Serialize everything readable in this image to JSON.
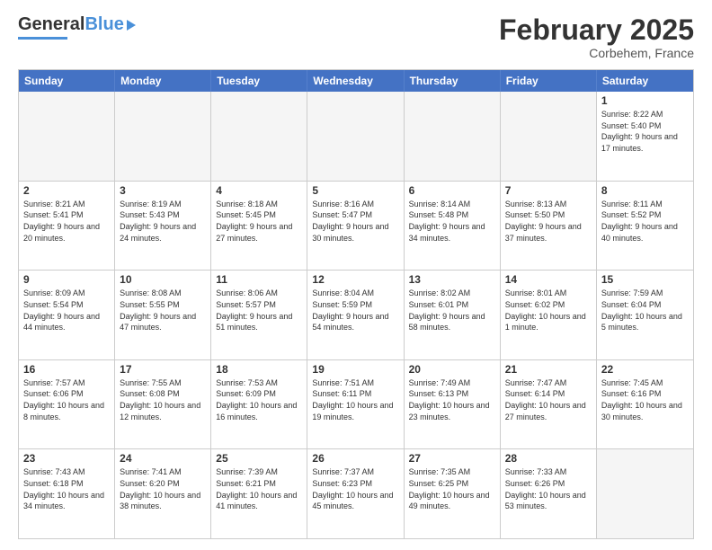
{
  "header": {
    "logo_general": "General",
    "logo_blue": "Blue",
    "month_title": "February 2025",
    "location": "Corbehem, France"
  },
  "weekdays": [
    "Sunday",
    "Monday",
    "Tuesday",
    "Wednesday",
    "Thursday",
    "Friday",
    "Saturday"
  ],
  "weeks": [
    [
      {
        "day": "",
        "info": ""
      },
      {
        "day": "",
        "info": ""
      },
      {
        "day": "",
        "info": ""
      },
      {
        "day": "",
        "info": ""
      },
      {
        "day": "",
        "info": ""
      },
      {
        "day": "",
        "info": ""
      },
      {
        "day": "1",
        "info": "Sunrise: 8:22 AM\nSunset: 5:40 PM\nDaylight: 9 hours and 17 minutes."
      }
    ],
    [
      {
        "day": "2",
        "info": "Sunrise: 8:21 AM\nSunset: 5:41 PM\nDaylight: 9 hours and 20 minutes."
      },
      {
        "day": "3",
        "info": "Sunrise: 8:19 AM\nSunset: 5:43 PM\nDaylight: 9 hours and 24 minutes."
      },
      {
        "day": "4",
        "info": "Sunrise: 8:18 AM\nSunset: 5:45 PM\nDaylight: 9 hours and 27 minutes."
      },
      {
        "day": "5",
        "info": "Sunrise: 8:16 AM\nSunset: 5:47 PM\nDaylight: 9 hours and 30 minutes."
      },
      {
        "day": "6",
        "info": "Sunrise: 8:14 AM\nSunset: 5:48 PM\nDaylight: 9 hours and 34 minutes."
      },
      {
        "day": "7",
        "info": "Sunrise: 8:13 AM\nSunset: 5:50 PM\nDaylight: 9 hours and 37 minutes."
      },
      {
        "day": "8",
        "info": "Sunrise: 8:11 AM\nSunset: 5:52 PM\nDaylight: 9 hours and 40 minutes."
      }
    ],
    [
      {
        "day": "9",
        "info": "Sunrise: 8:09 AM\nSunset: 5:54 PM\nDaylight: 9 hours and 44 minutes."
      },
      {
        "day": "10",
        "info": "Sunrise: 8:08 AM\nSunset: 5:55 PM\nDaylight: 9 hours and 47 minutes."
      },
      {
        "day": "11",
        "info": "Sunrise: 8:06 AM\nSunset: 5:57 PM\nDaylight: 9 hours and 51 minutes."
      },
      {
        "day": "12",
        "info": "Sunrise: 8:04 AM\nSunset: 5:59 PM\nDaylight: 9 hours and 54 minutes."
      },
      {
        "day": "13",
        "info": "Sunrise: 8:02 AM\nSunset: 6:01 PM\nDaylight: 9 hours and 58 minutes."
      },
      {
        "day": "14",
        "info": "Sunrise: 8:01 AM\nSunset: 6:02 PM\nDaylight: 10 hours and 1 minute."
      },
      {
        "day": "15",
        "info": "Sunrise: 7:59 AM\nSunset: 6:04 PM\nDaylight: 10 hours and 5 minutes."
      }
    ],
    [
      {
        "day": "16",
        "info": "Sunrise: 7:57 AM\nSunset: 6:06 PM\nDaylight: 10 hours and 8 minutes."
      },
      {
        "day": "17",
        "info": "Sunrise: 7:55 AM\nSunset: 6:08 PM\nDaylight: 10 hours and 12 minutes."
      },
      {
        "day": "18",
        "info": "Sunrise: 7:53 AM\nSunset: 6:09 PM\nDaylight: 10 hours and 16 minutes."
      },
      {
        "day": "19",
        "info": "Sunrise: 7:51 AM\nSunset: 6:11 PM\nDaylight: 10 hours and 19 minutes."
      },
      {
        "day": "20",
        "info": "Sunrise: 7:49 AM\nSunset: 6:13 PM\nDaylight: 10 hours and 23 minutes."
      },
      {
        "day": "21",
        "info": "Sunrise: 7:47 AM\nSunset: 6:14 PM\nDaylight: 10 hours and 27 minutes."
      },
      {
        "day": "22",
        "info": "Sunrise: 7:45 AM\nSunset: 6:16 PM\nDaylight: 10 hours and 30 minutes."
      }
    ],
    [
      {
        "day": "23",
        "info": "Sunrise: 7:43 AM\nSunset: 6:18 PM\nDaylight: 10 hours and 34 minutes."
      },
      {
        "day": "24",
        "info": "Sunrise: 7:41 AM\nSunset: 6:20 PM\nDaylight: 10 hours and 38 minutes."
      },
      {
        "day": "25",
        "info": "Sunrise: 7:39 AM\nSunset: 6:21 PM\nDaylight: 10 hours and 41 minutes."
      },
      {
        "day": "26",
        "info": "Sunrise: 7:37 AM\nSunset: 6:23 PM\nDaylight: 10 hours and 45 minutes."
      },
      {
        "day": "27",
        "info": "Sunrise: 7:35 AM\nSunset: 6:25 PM\nDaylight: 10 hours and 49 minutes."
      },
      {
        "day": "28",
        "info": "Sunrise: 7:33 AM\nSunset: 6:26 PM\nDaylight: 10 hours and 53 minutes."
      },
      {
        "day": "",
        "info": ""
      }
    ]
  ]
}
